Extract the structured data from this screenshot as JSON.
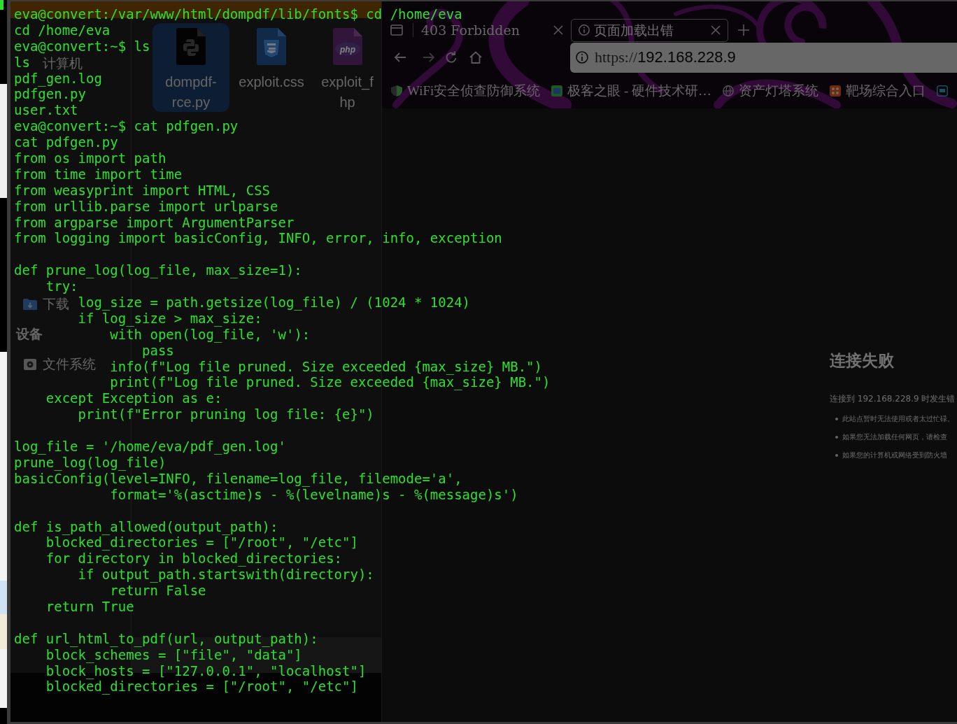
{
  "terminal": {
    "blocks": [
      [
        "eva@convert:/var/www/html/dompdf/lib/fonts$ cd /home/eva",
        "cd /home/eva",
        "eva@convert:~$ ls",
        "ls",
        "pdf_gen.log",
        "pdfgen.py",
        "user.txt",
        "eva@convert:~$ cat pdfgen.py",
        "cat pdfgen.py",
        "from os import path",
        "from time import time",
        "from weasyprint import HTML, CSS",
        "from urllib.parse import urlparse",
        "from argparse import ArgumentParser",
        "from logging import basicConfig, INFO, error, info, exception"
      ],
      [
        "def prune_log(log_file, max_size=1):",
        "    try:",
        "        log_size = path.getsize(log_file) / (1024 * 1024)",
        "        if log_size > max_size:",
        "            with open(log_file, 'w'):",
        "                pass",
        "            info(f\"Log file pruned. Size exceeded {max_size} MB.\")",
        "            print(f\"Log file pruned. Size exceeded {max_size} MB.\")",
        "    except Exception as e:",
        "        print(f\"Error pruning log file: {e}\")"
      ],
      [
        "log_file = '/home/eva/pdf_gen.log'",
        "prune_log(log_file)",
        "basicConfig(level=INFO, filename=log_file, filemode='a',",
        "            format='%(asctime)s - %(levelname)s - %(message)s')"
      ],
      [
        "def is_path_allowed(output_path):",
        "    blocked_directories = [\"/root\", \"/etc\"]",
        "    for directory in blocked_directories:",
        "        if output_path.startswith(directory):",
        "            return False",
        "    return True"
      ],
      [
        "def url_html_to_pdf(url, output_path):",
        "    block_schemes = [\"file\", \"data\"]",
        "    block_hosts = [\"127.0.0.1\", \"localhost\"]",
        "    blocked_directories = [\"/root\", \"/etc\"]"
      ]
    ]
  },
  "file_manager": {
    "sidebar": [
      {
        "kind": "place",
        "label": "计算机"
      },
      {
        "kind": "downloads",
        "label": "下载"
      },
      {
        "kind": "heading",
        "label": "设备"
      },
      {
        "kind": "drive",
        "label": "文件系统"
      }
    ],
    "files": [
      {
        "kind": "python",
        "lines": [
          "dompdf-",
          "rce.py"
        ],
        "selected": true
      },
      {
        "kind": "css",
        "lines": [
          "exploit.css"
        ],
        "selected": false
      },
      {
        "kind": "php",
        "icon_label": "php",
        "lines": [
          "exploit_f",
          "hp"
        ],
        "selected": false
      }
    ]
  },
  "browser": {
    "tabs": [
      {
        "kind": "page",
        "title": "403 Forbidden",
        "selected": false
      },
      {
        "kind": "error",
        "title": "页面加载出错",
        "selected": true
      }
    ],
    "address": {
      "scheme": "https://",
      "host": "192.168.228.9"
    },
    "bookmarks": [
      {
        "kind": "shield",
        "label": "WiFi安全侦查防御系统"
      },
      {
        "kind": "tile",
        "label": "极客之眼 - 硬件技术研…"
      },
      {
        "kind": "globe",
        "label": "资产灯塔系统"
      },
      {
        "kind": "grid",
        "label": "靶场综合入口"
      },
      {
        "kind": "monitor"
      }
    ],
    "error_page": {
      "title": "连接失败",
      "message": "连接到 192.168.228.9 时发生错",
      "hints": [
        "此站点暂时无法使用或者太过忙碌。",
        "如果您无法加载任何网页，请检查",
        "如果您的计算机或网络受到防火墙"
      ]
    }
  }
}
